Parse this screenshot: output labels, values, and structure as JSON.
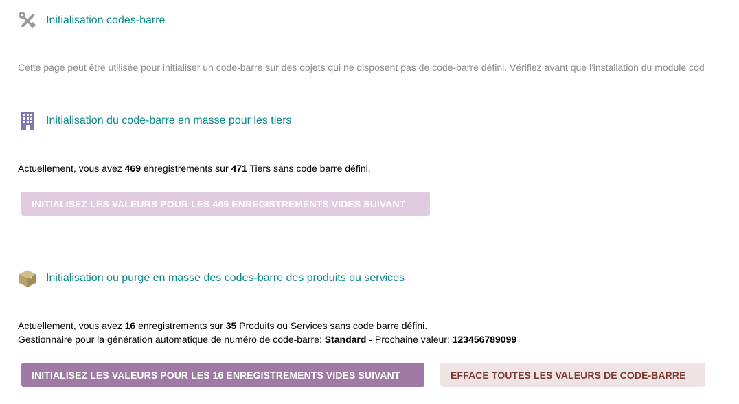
{
  "header": {
    "title": "Initialisation codes-barre",
    "icon": "tools-icon"
  },
  "intro": "Cette page peut être utilisée pour initialiser un code-barre sur des objets qui ne disposent pas de code-barre défini. Vérifiez avant que l'installation du module cod",
  "colors": {
    "title": "#0a8a8a",
    "intro": "#8c8c8c",
    "primary_button": "#a07aa5",
    "disabled_button": "#e1cbe0",
    "danger_button_bg": "#efe4e3",
    "danger_button_text": "#7a3a35",
    "company_icon": "#7e78b0",
    "product_icon": "#b9a26a"
  },
  "thirdparty": {
    "title": "Initialisation du code-barre en masse pour les tiers",
    "icon": "building-icon",
    "text_prefix": "Actuellement, vous avez ",
    "count_empty": "469",
    "text_middle": " enregistrements sur ",
    "count_total": "471",
    "text_suffix": " Tiers sans code barre défini.",
    "button_label": "INITIALISEZ LES VALEURS POUR LES 469 ENREGISTREMENTS VIDES SUIVANT"
  },
  "products": {
    "title": "Initialisation ou purge en masse des codes-barre des produits ou services",
    "icon": "box-icon",
    "text_prefix": "Actuellement, vous avez ",
    "count_empty": "16",
    "text_middle": " enregistrements sur ",
    "count_total": "35",
    "text_suffix": " Produits ou Services sans code barre défini.",
    "manager_prefix": "Gestionnaire pour la génération automatique de numéro de code-barre: ",
    "manager_name": "Standard",
    "next_value_prefix": " - Prochaine valeur: ",
    "next_value": "123456789099",
    "init_button_label": "INITIALISEZ LES VALEURS POUR LES 16 ENREGISTREMENTS VIDES SUIVANT",
    "erase_button_label": "EFFACE TOUTES LES VALEURS DE CODE-BARRE"
  }
}
